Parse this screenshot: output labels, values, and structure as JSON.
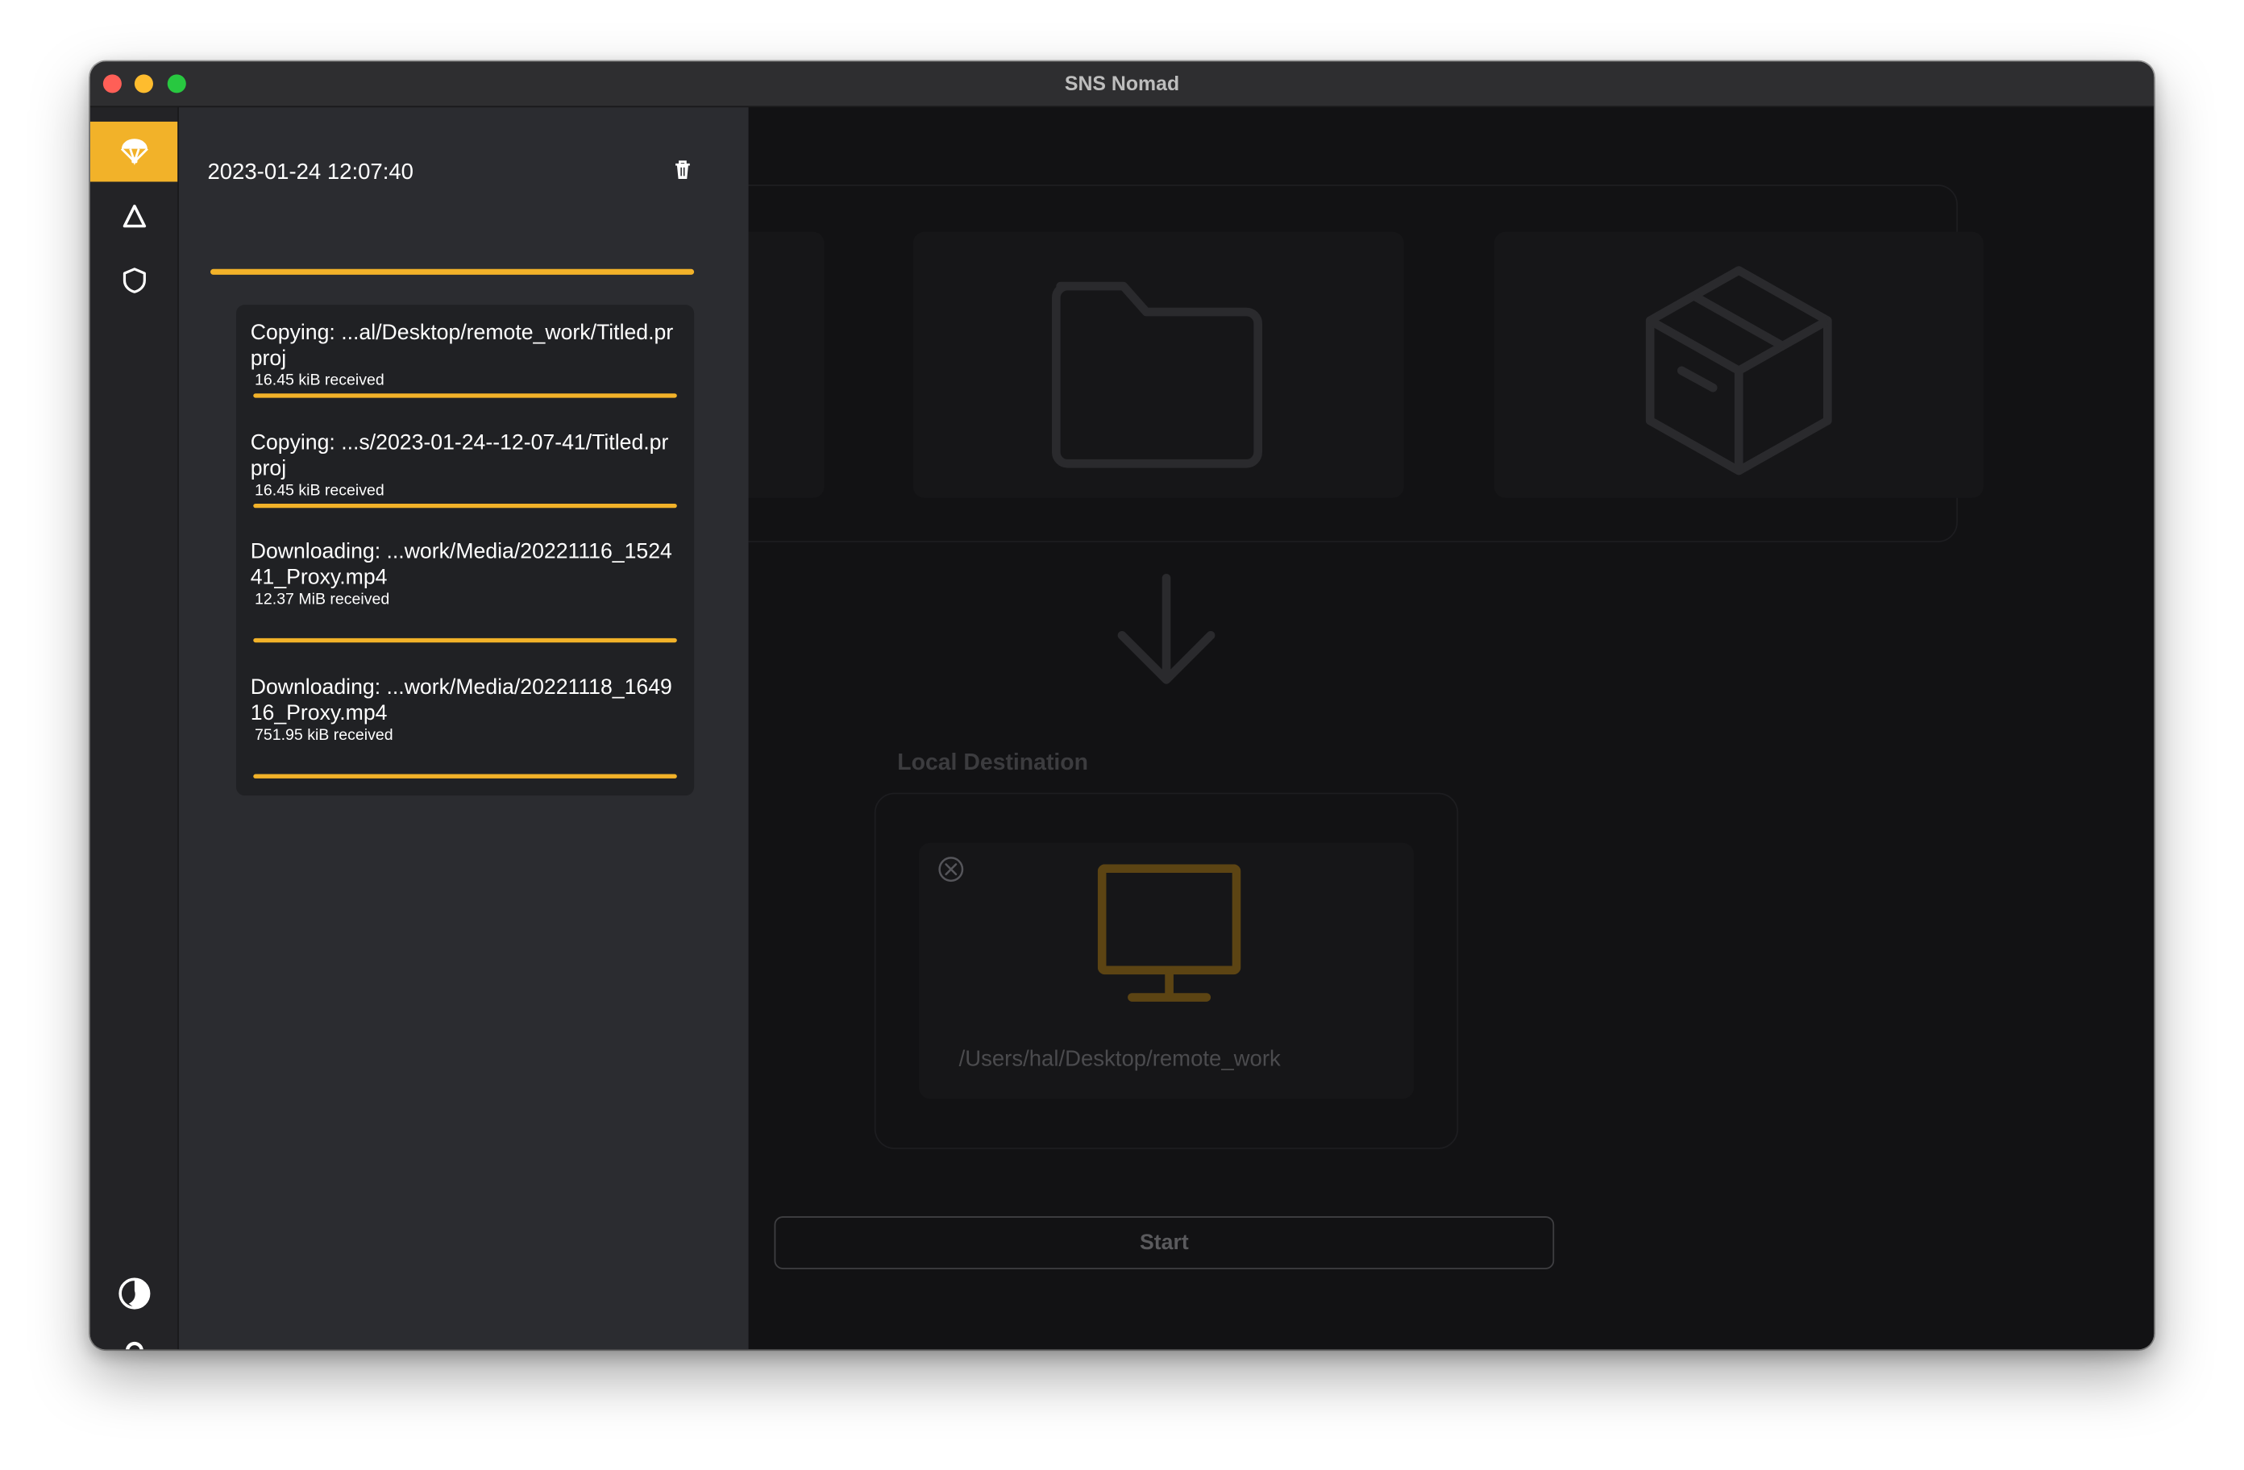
{
  "window": {
    "title": "SNS Nomad"
  },
  "nav": {
    "items": [
      {
        "id": "transfers",
        "icon": "parachute-icon",
        "active": true
      },
      {
        "id": "delta",
        "icon": "delta-icon",
        "active": false
      },
      {
        "id": "security",
        "icon": "shield-icon",
        "active": false
      }
    ],
    "bottom_items": [
      {
        "id": "theme",
        "icon": "half-circle-icon"
      },
      {
        "id": "help",
        "icon": "question-icon"
      }
    ]
  },
  "drawer": {
    "timestamp": "2023-01-24 12:07:40",
    "progress": 1.0,
    "jobs": [
      {
        "label": "Copying: ...al/Desktop/remote_work/Titled.prproj",
        "size": "16.45 kiB received",
        "progress": 1.0
      },
      {
        "label": "Copying: ...s/2023-01-24--12-07-41/Titled.prproj",
        "size": "16.45 kiB received",
        "progress": 1.0
      },
      {
        "label": "Downloading: ...work/Media/20221116_152441_Proxy.mp4",
        "size": "12.37 MiB received",
        "progress": 1.0
      },
      {
        "label": "Downloading: ...work/Media/20221118_164916_Proxy.mp4",
        "size": "751.95 kiB received",
        "progress": 1.0
      }
    ]
  },
  "main": {
    "source_icons": [
      "folder-icon",
      "box-icon"
    ],
    "destination": {
      "label": "Local Destination",
      "path": "/Users/hal/Desktop/remote_work",
      "icon": "monitor-icon"
    },
    "start_label": "Start"
  },
  "colors": {
    "accent": "#f2b229",
    "background": "#121214",
    "drawer": "#2b2c30",
    "sidebar": "#232326"
  }
}
